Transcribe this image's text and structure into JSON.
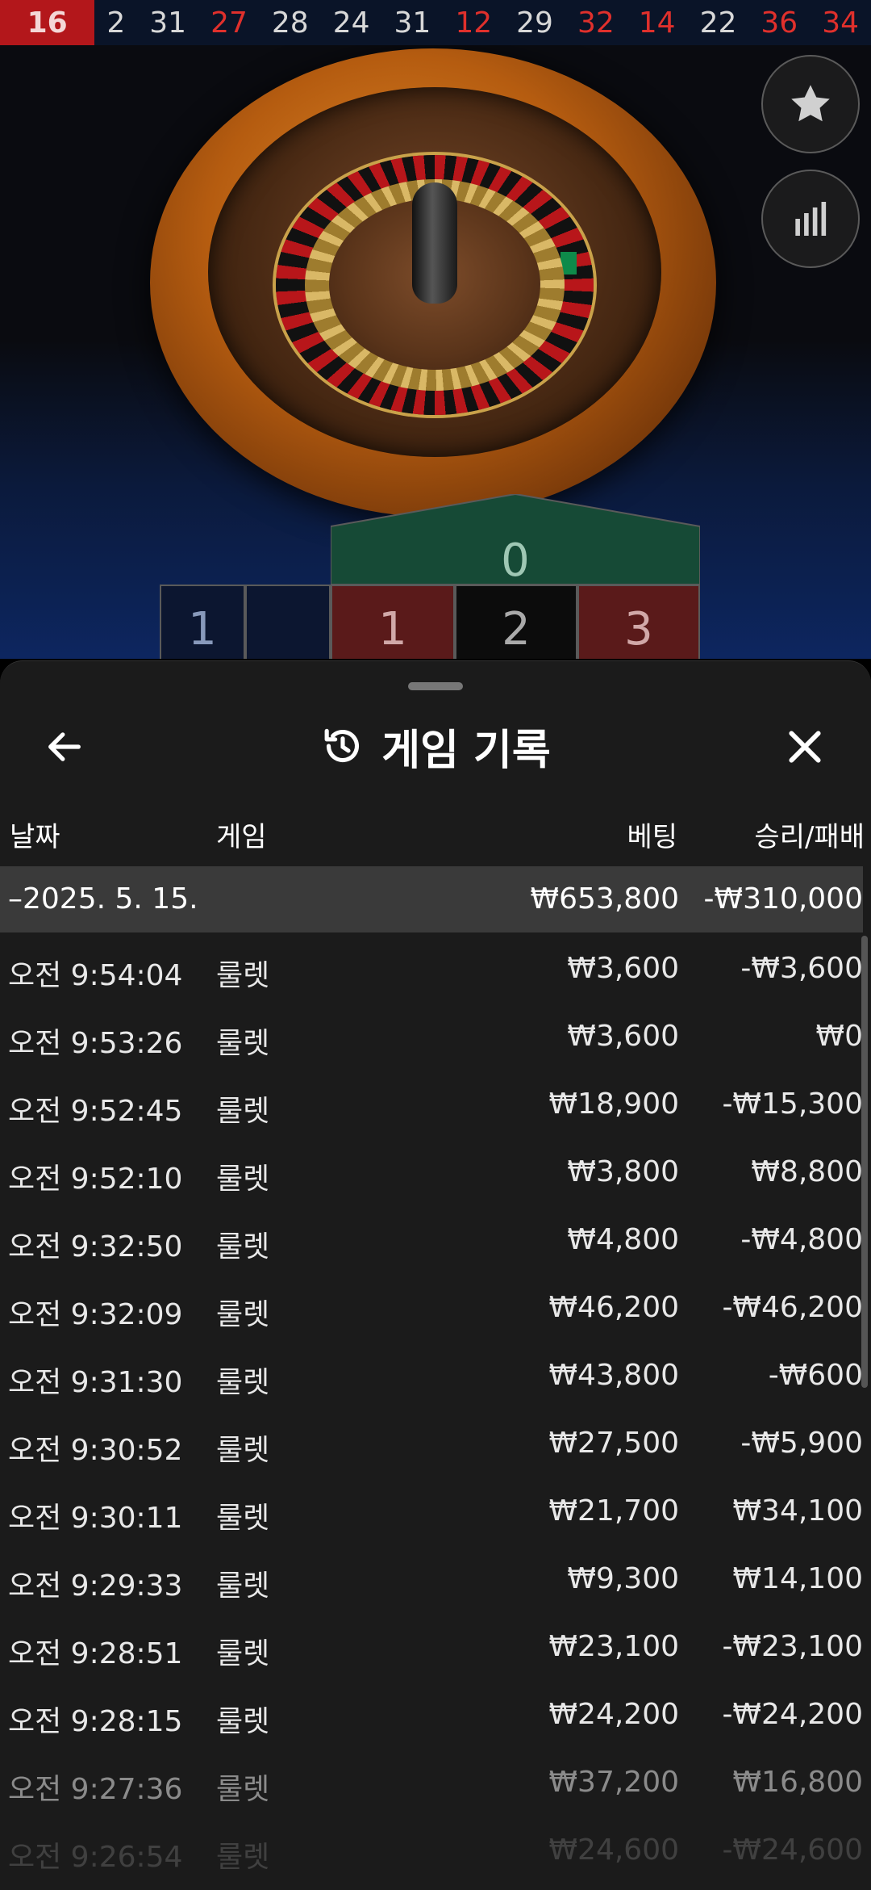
{
  "results_bar": {
    "latest": "16",
    "history": [
      {
        "n": "2",
        "color": "black"
      },
      {
        "n": "31",
        "color": "black"
      },
      {
        "n": "27",
        "color": "red"
      },
      {
        "n": "28",
        "color": "black"
      },
      {
        "n": "24",
        "color": "black"
      },
      {
        "n": "31",
        "color": "black"
      },
      {
        "n": "12",
        "color": "red"
      },
      {
        "n": "29",
        "color": "black"
      },
      {
        "n": "32",
        "color": "red"
      },
      {
        "n": "14",
        "color": "red"
      },
      {
        "n": "22",
        "color": "black"
      },
      {
        "n": "36",
        "color": "red"
      },
      {
        "n": "34",
        "color": "red"
      }
    ]
  },
  "side_buttons": {
    "favorite_icon": "star-icon",
    "stats_icon": "bar-chart-icon"
  },
  "table": {
    "zero": "0",
    "cells": [
      "1",
      "2",
      "3"
    ],
    "partial_left": "1"
  },
  "sheet": {
    "title": "게임 기록",
    "title_icon": "history-icon",
    "back_icon": "arrow-left-icon",
    "close_icon": "close-icon",
    "columns": {
      "date": "날짜",
      "game": "게임",
      "bet": "베팅",
      "result": "승리/패배"
    },
    "day": {
      "toggle": "–",
      "date": "2025. 5. 15.",
      "bet": "₩653,800",
      "result": "-₩310,000"
    },
    "rows": [
      {
        "time": "오전 9:54:04",
        "game": "룰렛",
        "bet": "₩3,600",
        "result": "-₩3,600"
      },
      {
        "time": "오전 9:53:26",
        "game": "룰렛",
        "bet": "₩3,600",
        "result": "₩0"
      },
      {
        "time": "오전 9:52:45",
        "game": "룰렛",
        "bet": "₩18,900",
        "result": "-₩15,300"
      },
      {
        "time": "오전 9:52:10",
        "game": "룰렛",
        "bet": "₩3,800",
        "result": "₩8,800"
      },
      {
        "time": "오전 9:32:50",
        "game": "룰렛",
        "bet": "₩4,800",
        "result": "-₩4,800"
      },
      {
        "time": "오전 9:32:09",
        "game": "룰렛",
        "bet": "₩46,200",
        "result": "-₩46,200"
      },
      {
        "time": "오전 9:31:30",
        "game": "룰렛",
        "bet": "₩43,800",
        "result": "-₩600"
      },
      {
        "time": "오전 9:30:52",
        "game": "룰렛",
        "bet": "₩27,500",
        "result": "-₩5,900"
      },
      {
        "time": "오전 9:30:11",
        "game": "룰렛",
        "bet": "₩21,700",
        "result": "₩34,100"
      },
      {
        "time": "오전 9:29:33",
        "game": "룰렛",
        "bet": "₩9,300",
        "result": "₩14,100"
      },
      {
        "time": "오전 9:28:51",
        "game": "룰렛",
        "bet": "₩23,100",
        "result": "-₩23,100"
      },
      {
        "time": "오전 9:28:15",
        "game": "룰렛",
        "bet": "₩24,200",
        "result": "-₩24,200"
      },
      {
        "time": "오전 9:27:36",
        "game": "룰렛",
        "bet": "₩37,200",
        "result": "₩16,800"
      },
      {
        "time": "오전 9:26:54",
        "game": "룰렛",
        "bet": "₩24,600",
        "result": "-₩24,600"
      }
    ]
  }
}
